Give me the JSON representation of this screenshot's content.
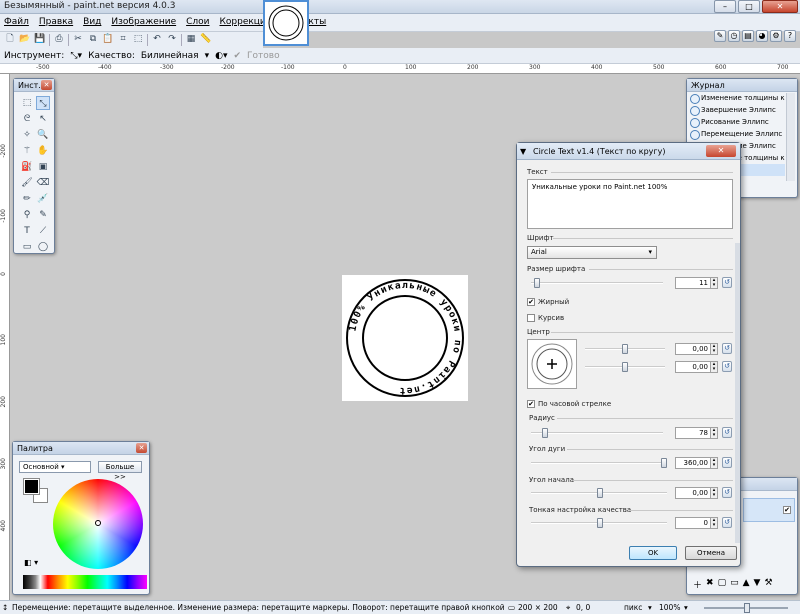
{
  "window": {
    "title": "Безымянный - paint.net версия 4.0.3"
  },
  "menu": [
    "Файл",
    "Правка",
    "Вид",
    "Изображение",
    "Слои",
    "Коррекция",
    "Эффекты"
  ],
  "toolbar2": {
    "tool_label": "Инструмент:",
    "quality_label": "Качество:",
    "quality_value": "Билинейная",
    "done_label": "Готово"
  },
  "ruler": {
    "h": [
      "-500",
      "-400",
      "-300",
      "-200",
      "-100",
      "0",
      "100",
      "200",
      "300",
      "400",
      "500",
      "600",
      "700"
    ],
    "v": [
      "-200",
      "-100",
      "0",
      "100",
      "200",
      "300",
      "400"
    ]
  },
  "tools": {
    "title": "Инст…"
  },
  "palette": {
    "title": "Палитра",
    "mode": "Основной",
    "more_button": "Больше >>",
    "primary_color": "#000000",
    "secondary_color": "#ffffff"
  },
  "history": {
    "title": "Журнал",
    "items": [
      "Изменение толщины кисти",
      "Завершение Эллипс",
      "Рисование Эллипс",
      "Перемещение Эллипс",
      "Завершение Эллипс",
      "Изменение толщины кисти",
      "…е Эллипс"
    ]
  },
  "stamp": {
    "text": "100% Уникальные уроки по Paint.net"
  },
  "dialog": {
    "title": "Circle Text v1.4 (Текст по кругу)",
    "text_label": "Текст",
    "text_value": "Уникальные уроки по Paint.net 100%",
    "font_label": "Шрифт",
    "font_value": "Arial",
    "size_label": "Размер шрифта",
    "size_value": "11",
    "bold_label": "Жирный",
    "italic_label": "Курсив",
    "center_label": "Центр",
    "center_x": "0,00",
    "center_y": "0,00",
    "clockwise_label": "По часовой стрелке",
    "radius_label": "Радиус",
    "radius_value": "78",
    "arc_label": "Угол дуги",
    "arc_value": "360,00",
    "start_label": "Угол начала",
    "start_value": "0,00",
    "quality_label": "Тонкая настройка качества",
    "quality_value": "0",
    "ok": "OK",
    "cancel": "Отмена"
  },
  "status": {
    "hint": "Перемещение: перетащите выделенное. Изменение размера: перетащите маркеры. Поворот: перетащите правой кнопкой.",
    "image_size": "200 × 200",
    "selection": "0, 0",
    "unit": "пикс",
    "zoom": "100%"
  }
}
